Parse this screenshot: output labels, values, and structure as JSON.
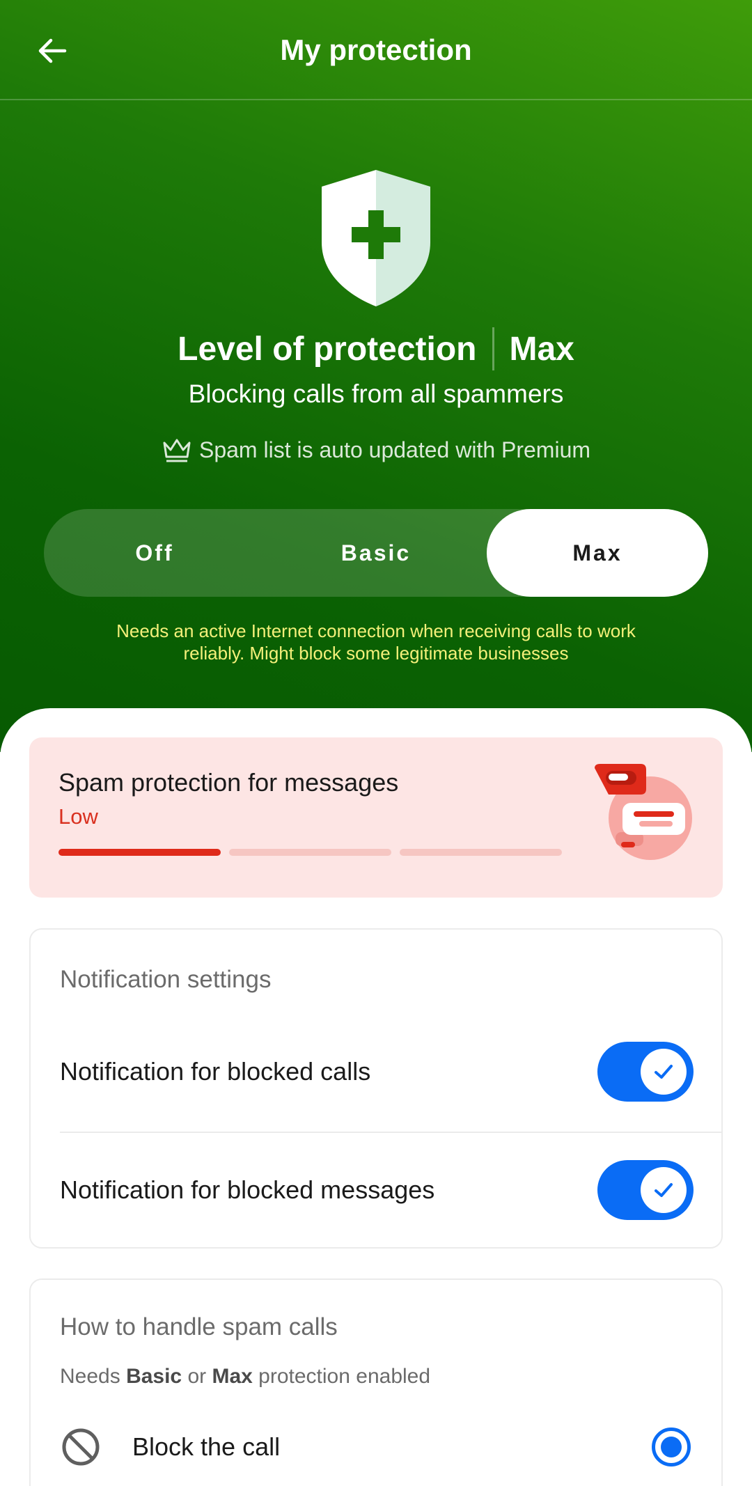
{
  "header": {
    "title": "My protection",
    "back_icon": "arrow-left-icon"
  },
  "protection": {
    "icon": "shield-plus-icon",
    "level_label": "Level of protection",
    "level_value": "Max",
    "description": "Blocking calls from all spammers",
    "premium_icon": "crown-icon",
    "premium_note": "Spam list is auto updated with Premium",
    "options": [
      "Off",
      "Basic",
      "Max"
    ],
    "selected": "Max",
    "warning": "Needs an active Internet connection when receiving calls to work reliably. Might block some legitimate businesses"
  },
  "spam_messages": {
    "title": "Spam protection for messages",
    "level": "Low",
    "level_steps": 3,
    "level_active": 1,
    "illustration": "chat-bubbles-icon"
  },
  "notification_settings": {
    "heading": "Notification settings",
    "items": [
      {
        "label": "Notification for blocked calls",
        "enabled": true
      },
      {
        "label": "Notification for blocked messages",
        "enabled": true
      }
    ]
  },
  "spam_calls": {
    "heading": "How to handle spam calls",
    "note_prefix": "Needs ",
    "note_basic": "Basic",
    "note_mid": " or ",
    "note_max": "Max",
    "note_suffix": " protection enabled",
    "option": {
      "label": "Block the call",
      "icon": "block-icon",
      "selected": true
    }
  },
  "colors": {
    "hero_green": "#0b6203",
    "accent_blue": "#0a6cf5",
    "warning_yellow": "#f4f07a",
    "spam_red": "#df2a1a",
    "spam_bg": "#fde5e4"
  }
}
